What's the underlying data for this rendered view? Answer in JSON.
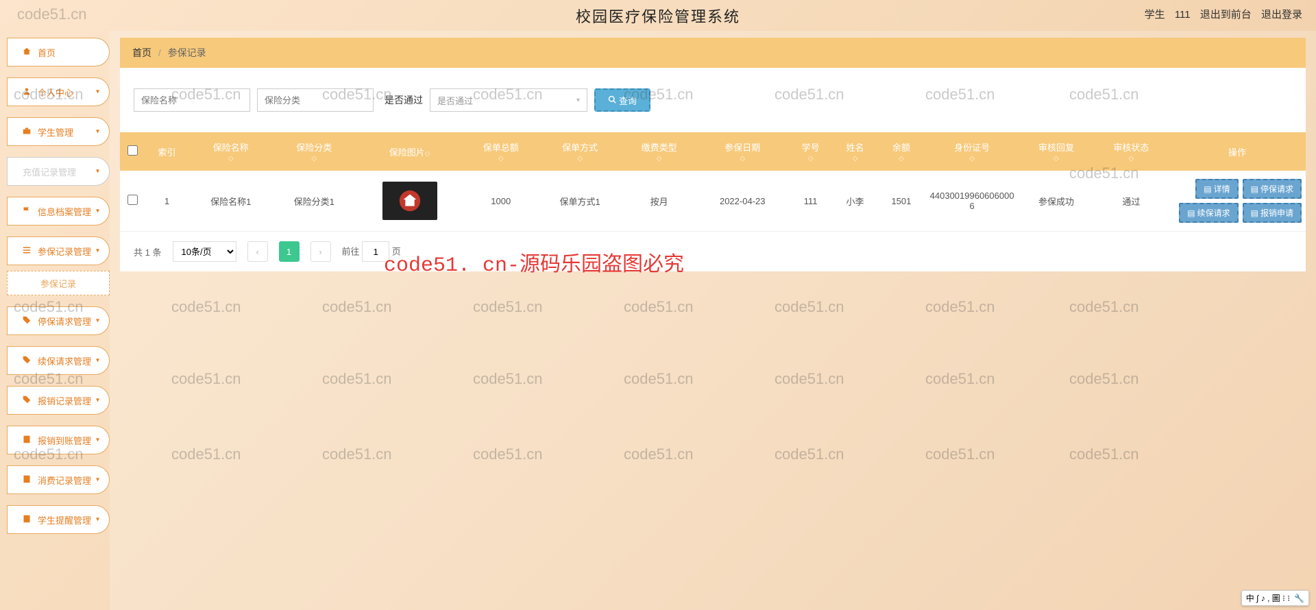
{
  "header": {
    "title": "校园医疗保险管理系统",
    "user_role": "学生",
    "user_name": "111",
    "logout_front": "退出到前台",
    "logout": "退出登录"
  },
  "sidebar": {
    "items": [
      {
        "label": "首页",
        "icon": "home"
      },
      {
        "label": "个人中心",
        "icon": "user"
      },
      {
        "label": "学生管理",
        "icon": "briefcase"
      },
      {
        "label": "充值记录管理",
        "icon": "file"
      },
      {
        "label": "信息档案管理",
        "icon": "flag"
      },
      {
        "label": "参保记录管理",
        "icon": "list"
      },
      {
        "label": "停保请求管理",
        "icon": "tag"
      },
      {
        "label": "续保请求管理",
        "icon": "tag"
      },
      {
        "label": "报销记录管理",
        "icon": "tag"
      },
      {
        "label": "报销到账管理",
        "icon": "file"
      },
      {
        "label": "消费记录管理",
        "icon": "file"
      },
      {
        "label": "学生提醒管理",
        "icon": "file"
      }
    ],
    "submenu": "参保记录"
  },
  "breadcrumb": {
    "home": "首页",
    "current": "参保记录"
  },
  "filter": {
    "name_placeholder": "保险名称",
    "category_placeholder": "保险分类",
    "pass_label": "是否通过",
    "pass_placeholder": "是否通过",
    "search_label": "查询"
  },
  "table": {
    "headers": [
      "索引",
      "保险名称",
      "保险分类",
      "保险图片",
      "保单总额",
      "保单方式",
      "缴费类型",
      "参保日期",
      "学号",
      "姓名",
      "余额",
      "身份证号",
      "审核回复",
      "审核状态",
      "操作"
    ],
    "rows": [
      {
        "idx": "1",
        "name": "保险名称1",
        "category": "保险分类1",
        "total": "1000",
        "method": "保单方式1",
        "paytype": "按月",
        "date": "2022-04-23",
        "student_no": "111",
        "student_name": "小李",
        "balance": "1501",
        "id_no": "440300199606060006",
        "review_reply": "参保成功",
        "review_status": "通过"
      }
    ],
    "ops": {
      "detail": "详情",
      "stop": "停保请求",
      "renew": "续保请求",
      "claim": "报销申请"
    }
  },
  "pager": {
    "total_prefix": "共",
    "total_count": "1",
    "total_suffix": "条",
    "page_size": "10条/页",
    "current": "1",
    "goto_prefix": "前往",
    "goto_value": "1",
    "goto_suffix": "页"
  },
  "watermark": "code51.cn",
  "watermark_red": "code51. cn-源码乐园盗图必究",
  "ime": {
    "text": "中 ∫ ♪ , 圖 ⁝ ⁝"
  }
}
